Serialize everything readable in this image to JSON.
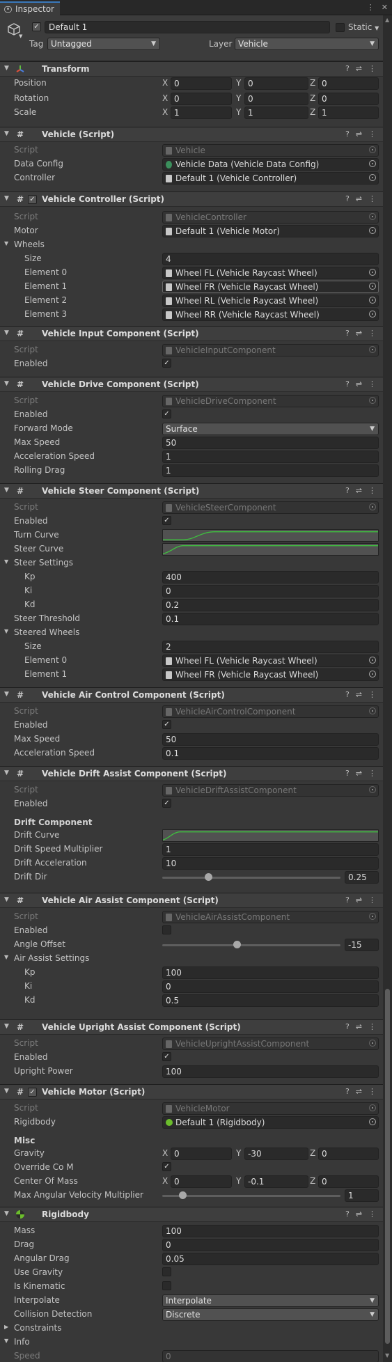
{
  "tab": {
    "title": "Inspector"
  },
  "object": {
    "name": "Default 1",
    "static_label": "Static",
    "tag_label": "Tag",
    "tag_value": "Untagged",
    "layer_label": "Layer",
    "layer_value": "Vehicle"
  },
  "transform": {
    "title": "Transform",
    "position_label": "Position",
    "position": {
      "x": "0",
      "y": "0",
      "z": "0"
    },
    "rotation_label": "Rotation",
    "rotation": {
      "x": "0",
      "y": "0",
      "z": "0"
    },
    "scale_label": "Scale",
    "scale": {
      "x": "1",
      "y": "1",
      "z": "1"
    },
    "x": "X",
    "y": "Y",
    "z": "Z"
  },
  "vehicle": {
    "title": "Vehicle (Script)",
    "script_label": "Script",
    "script_value": "Vehicle",
    "data_config_label": "Data Config",
    "data_config_value": "Vehicle Data (Vehicle Data Config)",
    "controller_label": "Controller",
    "controller_value": "Default 1 (Vehicle Controller)"
  },
  "controller": {
    "title": "Vehicle Controller (Script)",
    "script_label": "Script",
    "script_value": "VehicleController",
    "motor_label": "Motor",
    "motor_value": "Default 1 (Vehicle Motor)",
    "wheels_label": "Wheels",
    "size_label": "Size",
    "size_value": "4",
    "elements": [
      {
        "label": "Element 0",
        "value": "Wheel FL (Vehicle Raycast Wheel)"
      },
      {
        "label": "Element 1",
        "value": "Wheel FR (Vehicle Raycast Wheel)"
      },
      {
        "label": "Element 2",
        "value": "Wheel RL (Vehicle Raycast Wheel)"
      },
      {
        "label": "Element 3",
        "value": "Wheel RR (Vehicle Raycast Wheel)"
      }
    ]
  },
  "input": {
    "title": "Vehicle Input Component (Script)",
    "script_label": "Script",
    "script_value": "VehicleInputComponent",
    "enabled_label": "Enabled",
    "enabled": true
  },
  "drive": {
    "title": "Vehicle Drive Component (Script)",
    "script_label": "Script",
    "script_value": "VehicleDriveComponent",
    "enabled_label": "Enabled",
    "forward_mode_label": "Forward Mode",
    "forward_mode_value": "Surface",
    "max_speed_label": "Max Speed",
    "max_speed_value": "50",
    "accel_label": "Acceleration Speed",
    "accel_value": "1",
    "rolling_label": "Rolling Drag",
    "rolling_value": "1"
  },
  "steer": {
    "title": "Vehicle Steer Component (Script)",
    "script_label": "Script",
    "script_value": "VehicleSteerComponent",
    "enabled_label": "Enabled",
    "turn_curve_label": "Turn Curve",
    "steer_curve_label": "Steer Curve",
    "settings_label": "Steer Settings",
    "kp_label": "Kp",
    "kp_value": "400",
    "ki_label": "Ki",
    "ki_value": "0",
    "kd_label": "Kd",
    "kd_value": "0.2",
    "threshold_label": "Steer Threshold",
    "threshold_value": "0.1",
    "steered_wheels_label": "Steered Wheels",
    "size_label": "Size",
    "size_value": "2",
    "elements": [
      {
        "label": "Element 0",
        "value": "Wheel FL (Vehicle Raycast Wheel)"
      },
      {
        "label": "Element 1",
        "value": "Wheel FR (Vehicle Raycast Wheel)"
      }
    ]
  },
  "air_control": {
    "title": "Vehicle Air Control Component (Script)",
    "script_label": "Script",
    "script_value": "VehicleAirControlComponent",
    "enabled_label": "Enabled",
    "max_speed_label": "Max Speed",
    "max_speed_value": "50",
    "accel_label": "Acceleration Speed",
    "accel_value": "0.1"
  },
  "drift": {
    "title": "Vehicle Drift Assist Component (Script)",
    "script_label": "Script",
    "script_value": "VehicleDriftAssistComponent",
    "enabled_label": "Enabled",
    "section_label": "Drift Component",
    "curve_label": "Drift Curve",
    "speed_mult_label": "Drift Speed Multiplier",
    "speed_mult_value": "1",
    "accel_label": "Drift Acceleration",
    "accel_value": "10",
    "dir_label": "Drift Dir",
    "dir_value": "0.25",
    "dir_fraction": 0.25
  },
  "air_assist": {
    "title": "Vehicle Air Assist Component (Script)",
    "script_label": "Script",
    "script_value": "VehicleAirAssistComponent",
    "enabled_label": "Enabled",
    "angle_label": "Angle Offset",
    "angle_value": "-15",
    "settings_label": "Air Assist Settings",
    "kp_label": "Kp",
    "kp_value": "100",
    "ki_label": "Ki",
    "ki_value": "0",
    "kd_label": "Kd",
    "kd_value": "0.5"
  },
  "upright": {
    "title": "Vehicle Upright Assist Component (Script)",
    "script_label": "Script",
    "script_value": "VehicleUprightAssistComponent",
    "enabled_label": "Enabled",
    "power_label": "Upright Power",
    "power_value": "100"
  },
  "motor": {
    "title": "Vehicle Motor (Script)",
    "script_label": "Script",
    "script_value": "VehicleMotor",
    "rigidbody_label": "Rigidbody",
    "rigidbody_value": "Default 1 (Rigidbody)",
    "misc_label": "Misc",
    "gravity_label": "Gravity",
    "gravity": {
      "x": "0",
      "y": "-30",
      "z": "0"
    },
    "override_label": "Override Co M",
    "com_label": "Center Of Mass",
    "com": {
      "x": "0",
      "y": "-0.1",
      "z": "0"
    },
    "angvel_label": "Max Angular Velocity Multiplier",
    "angvel_value": "1",
    "x": "X",
    "y": "Y",
    "z": "Z"
  },
  "rigidbody": {
    "title": "Rigidbody",
    "mass_label": "Mass",
    "mass_value": "100",
    "drag_label": "Drag",
    "drag_value": "0",
    "angdrag_label": "Angular Drag",
    "angdrag_value": "0.05",
    "gravity_label": "Use Gravity",
    "kinematic_label": "Is Kinematic",
    "interp_label": "Interpolate",
    "interp_value": "Interpolate",
    "collision_label": "Collision Detection",
    "collision_value": "Discrete",
    "constraints_label": "Constraints",
    "info_label": "Info",
    "speed_label": "Speed",
    "speed_value": "0"
  },
  "icons": {
    "check": "✓",
    "help": "?",
    "settings": "⇌",
    "more": "⋮",
    "arrow_down": "▼",
    "arrow_right": "▶"
  }
}
